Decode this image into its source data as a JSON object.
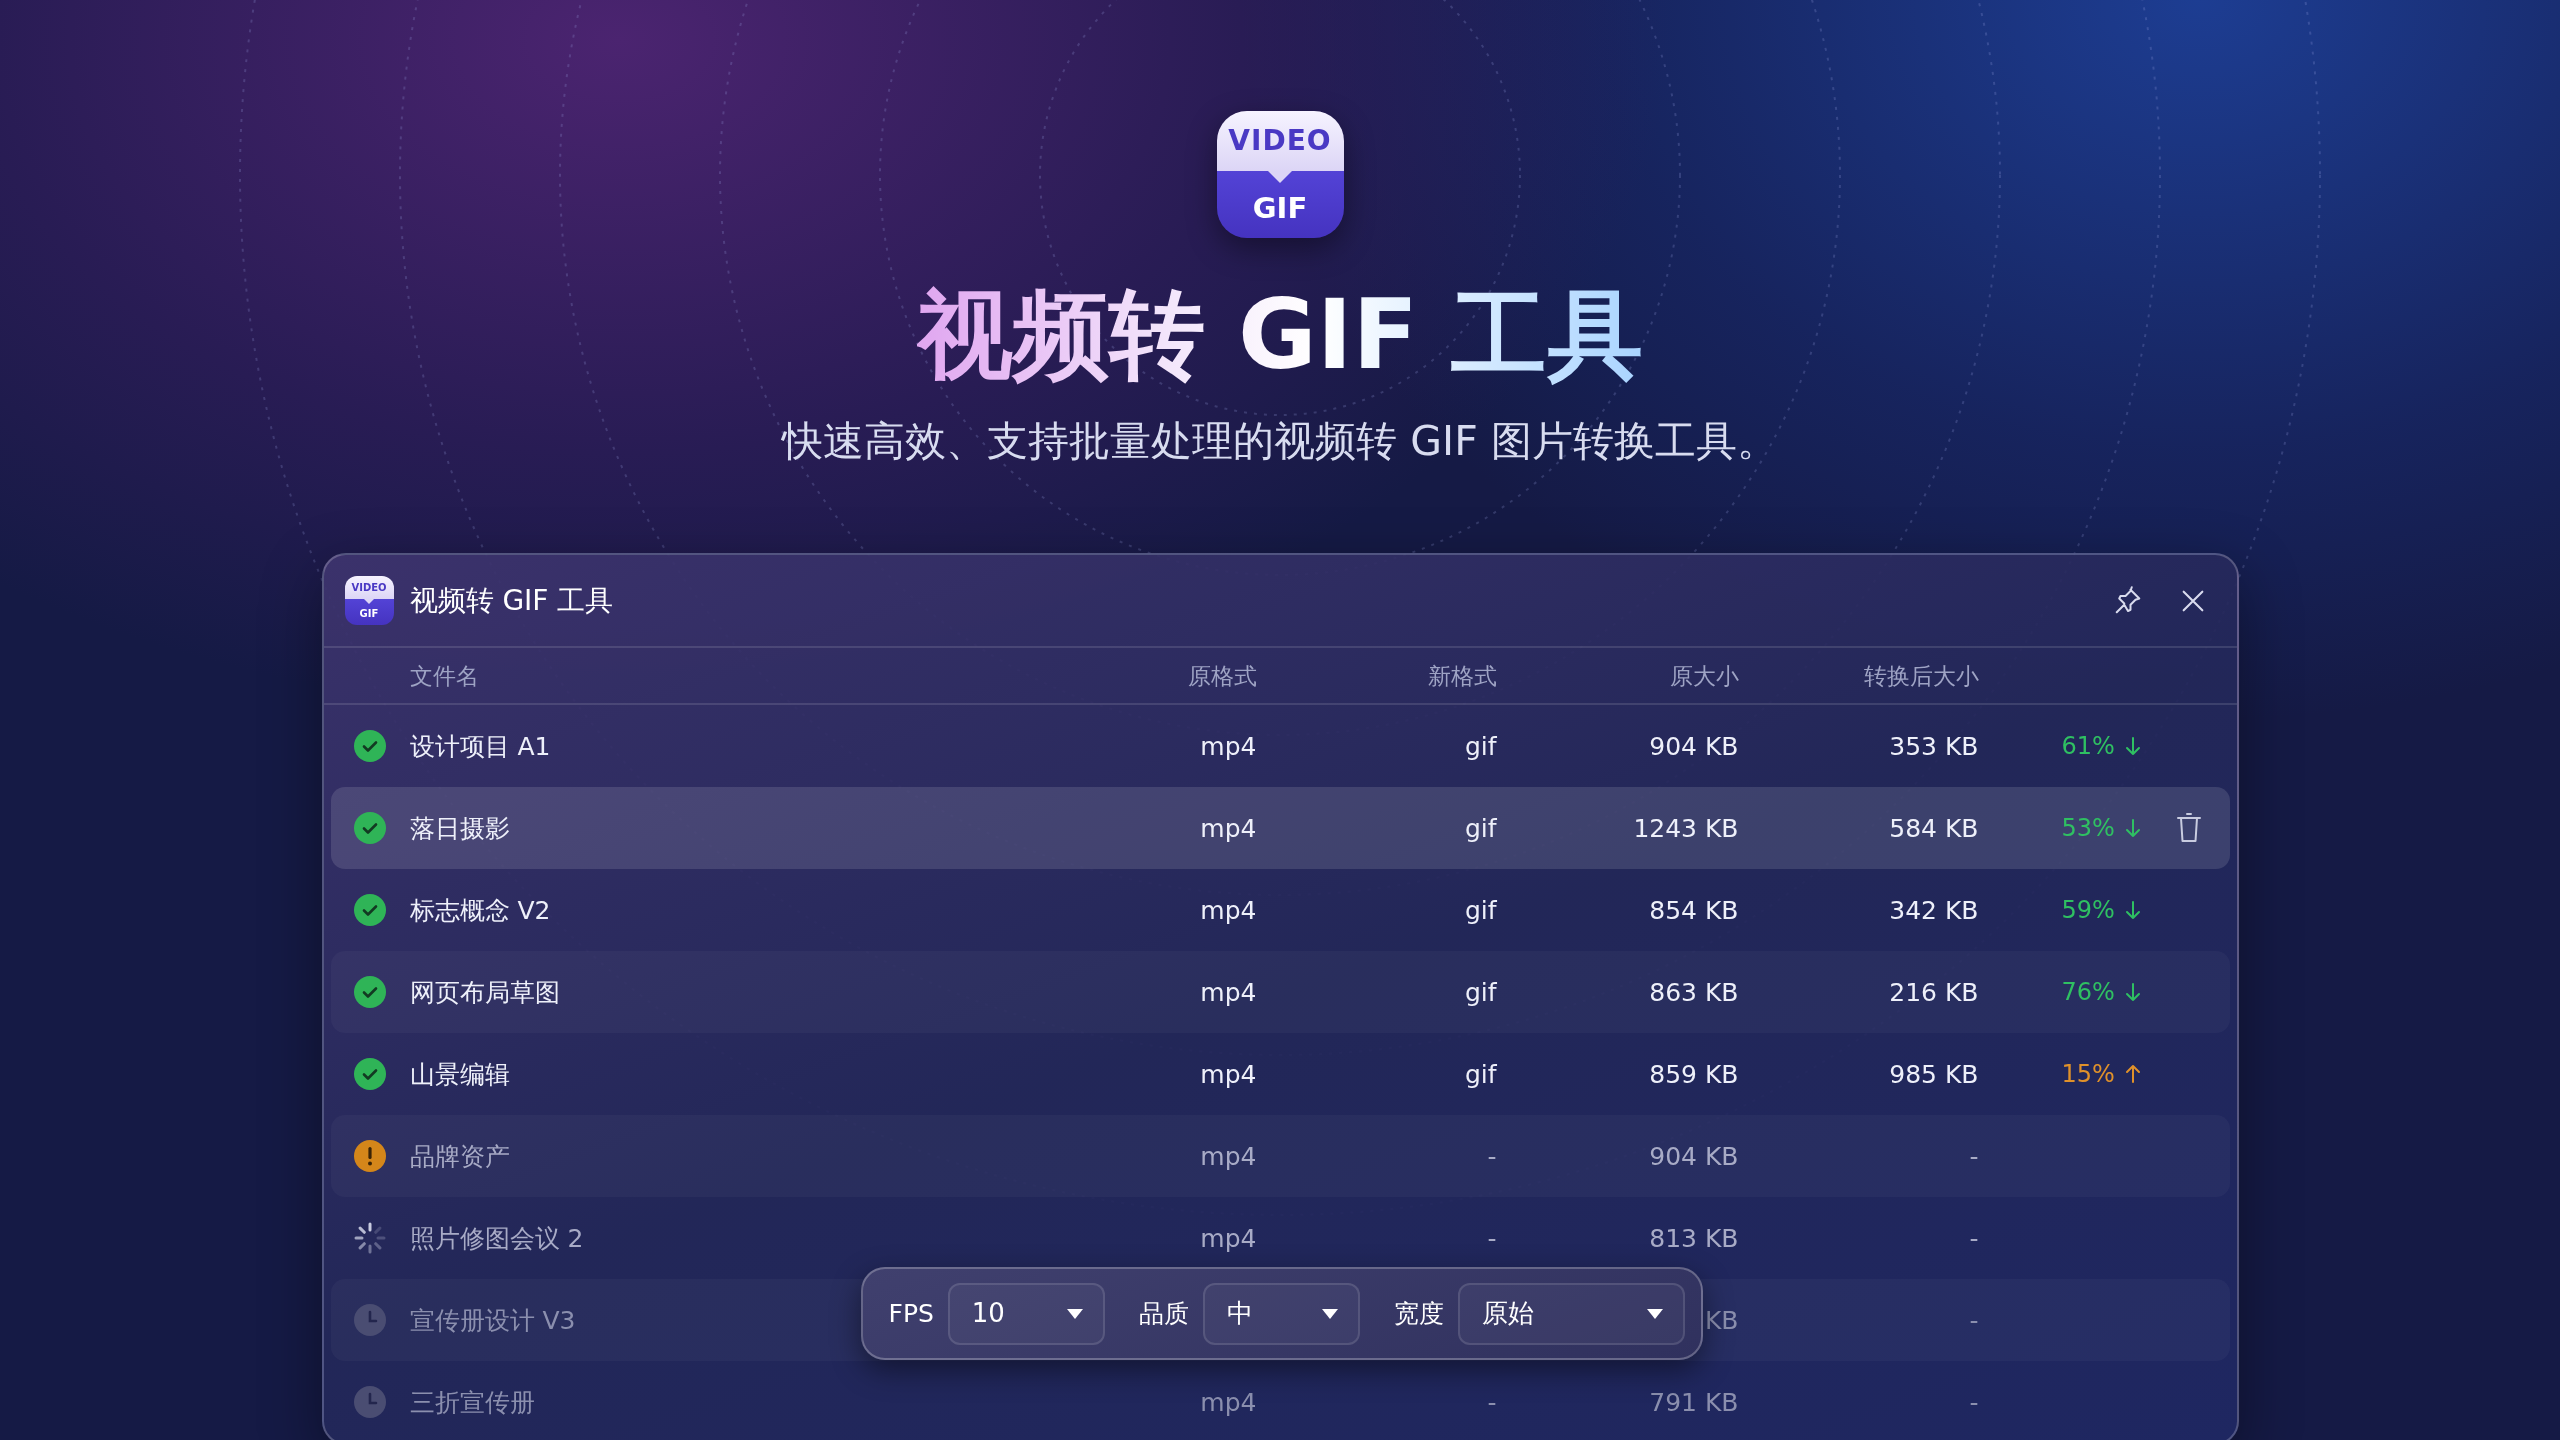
{
  "hero": {
    "logo": {
      "top": "VIDEO",
      "bottom": "GIF"
    },
    "title": "视频转 GIF 工具",
    "subtitle": "快速高效、支持批量处理的视频转 GIF 图片转换工具。"
  },
  "window": {
    "logo": {
      "top": "VIDEO",
      "bottom": "GIF"
    },
    "title": "视频转 GIF 工具"
  },
  "table": {
    "columns": [
      "文件名",
      "原格式",
      "新格式",
      "原大小",
      "转换后大小"
    ],
    "rows": [
      {
        "kind": "done",
        "name": "设计项目 A1",
        "format": "mp4",
        "new_format": "gif",
        "size": "904 KB",
        "converted_size": "353 KB",
        "change": {
          "text": "61%",
          "kind": "decrease"
        },
        "selected": false
      },
      {
        "kind": "done",
        "name": "落日摄影",
        "format": "mp4",
        "new_format": "gif",
        "size": "1243 KB",
        "converted_size": "584 KB",
        "change": {
          "text": "53%",
          "kind": "decrease"
        },
        "selected": true
      },
      {
        "kind": "done",
        "name": "标志概念 V2",
        "format": "mp4",
        "new_format": "gif",
        "size": "854 KB",
        "converted_size": "342 KB",
        "change": {
          "text": "59%",
          "kind": "decrease"
        },
        "selected": false
      },
      {
        "kind": "done",
        "name": "网页布局草图",
        "format": "mp4",
        "new_format": "gif",
        "size": "863 KB",
        "converted_size": "216 KB",
        "change": {
          "text": "76%",
          "kind": "decrease"
        },
        "selected": false
      },
      {
        "kind": "done",
        "name": "山景编辑",
        "format": "mp4",
        "new_format": "gif",
        "size": "859 KB",
        "converted_size": "985 KB",
        "change": {
          "text": "15%",
          "kind": "increase"
        },
        "selected": false
      },
      {
        "kind": "error",
        "name": "品牌资产",
        "format": "mp4",
        "new_format": "-",
        "size": "904 KB",
        "converted_size": "-",
        "selected": false
      },
      {
        "kind": "processing",
        "name": "照片修图会议 2",
        "format": "mp4",
        "new_format": "-",
        "size": "813 KB",
        "converted_size": "-",
        "selected": false
      },
      {
        "kind": "pending",
        "name": "宣传册设计 V3",
        "size": "KB",
        "converted_size": "-",
        "selected": false
      },
      {
        "kind": "pending",
        "name": "三折宣传册",
        "format": "mp4",
        "new_format": "-",
        "size": "791 KB",
        "converted_size": "-",
        "selected": false
      }
    ]
  },
  "toolbar": {
    "fields": [
      {
        "label": "FPS",
        "value": "10"
      },
      {
        "label": "品质",
        "value": "中"
      },
      {
        "label": "宽度",
        "value": "原始"
      }
    ]
  }
}
